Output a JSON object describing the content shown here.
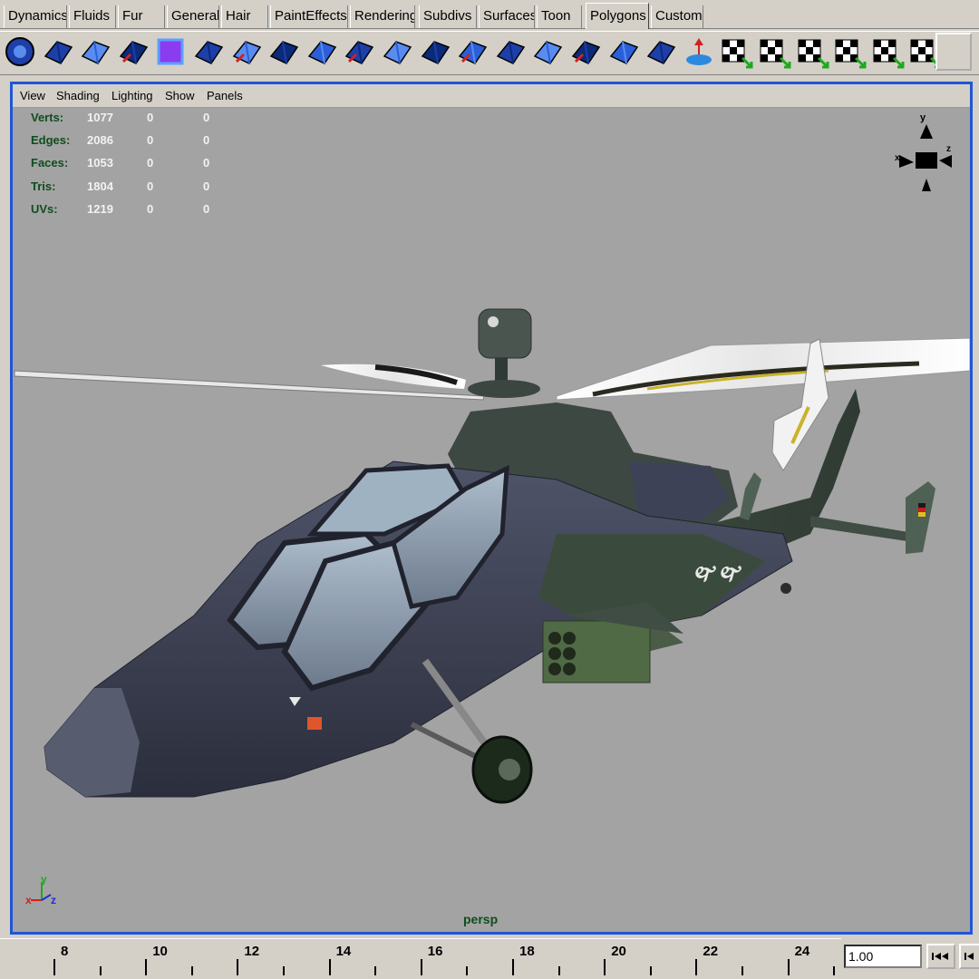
{
  "shelf_tabs": [
    {
      "label": "Dynamics",
      "active": false
    },
    {
      "label": "Fluids",
      "active": false
    },
    {
      "label": "Fur",
      "active": false
    },
    {
      "label": "General",
      "active": false
    },
    {
      "label": "Hair",
      "active": false
    },
    {
      "label": "PaintEffects",
      "active": false
    },
    {
      "label": "Rendering",
      "active": false
    },
    {
      "label": "Subdivs",
      "active": false
    },
    {
      "label": "Surfaces",
      "active": false
    },
    {
      "label": "Toon",
      "active": false
    },
    {
      "label": "Polygons",
      "active": true
    },
    {
      "label": "Custom",
      "active": false
    }
  ],
  "shelf_icons": [
    "polygon-sphere-icon",
    "polygon-plane-split-icon",
    "polygon-cylinder-icon",
    "polygon-cube-icon",
    "polygon-cube-wire-icon",
    "polygon-plane-icon",
    "split-polygon-icon",
    "extrude-face-icon",
    "extrude-edge-icon",
    "wedge-face-icon",
    "poke-face-icon",
    "subdivide-icon",
    "add-divisions-icon",
    "triangulate-icon",
    "merge-vertices-icon",
    "bevel-icon",
    "append-polygon-icon",
    "fill-hole-icon",
    "move-component-icon",
    "uv-planar-icon",
    "uv-auto-map-icon",
    "uv-cylindrical-icon",
    "uv-spherical-icon",
    "uv-editor-icon",
    "uv-texture-icon"
  ],
  "viewport": {
    "menus": [
      "View",
      "Shading",
      "Lighting",
      "Show",
      "Panels"
    ],
    "camera": "persp",
    "hud": [
      {
        "label": "Verts:",
        "values": [
          "1077",
          "0",
          "0"
        ]
      },
      {
        "label": "Edges:",
        "values": [
          "2086",
          "0",
          "0"
        ]
      },
      {
        "label": "Faces:",
        "values": [
          "1053",
          "0",
          "0"
        ]
      },
      {
        "label": "Tris:",
        "values": [
          "1804",
          "0",
          "0"
        ]
      },
      {
        "label": "UVs:",
        "values": [
          "1219",
          "0",
          "0"
        ]
      }
    ],
    "view_cube_axes": {
      "up": "y",
      "left": "x",
      "right": "z"
    },
    "axis_gizmo": {
      "x": "x",
      "y": "y",
      "z": "z"
    }
  },
  "timeline": {
    "labels": [
      "8",
      "10",
      "12",
      "14",
      "16",
      "18",
      "20",
      "22",
      "24"
    ],
    "current_frame": "1.00",
    "buttons": [
      "go-to-start-button",
      "step-back-button"
    ]
  },
  "colors": {
    "viewport_bg": "#a3a3a3",
    "active_panel_border": "#1f56d6",
    "ui_gray": "#d4d0c8",
    "hud_label": "#0f4d1e",
    "hud_value": "#f2f2f2"
  }
}
